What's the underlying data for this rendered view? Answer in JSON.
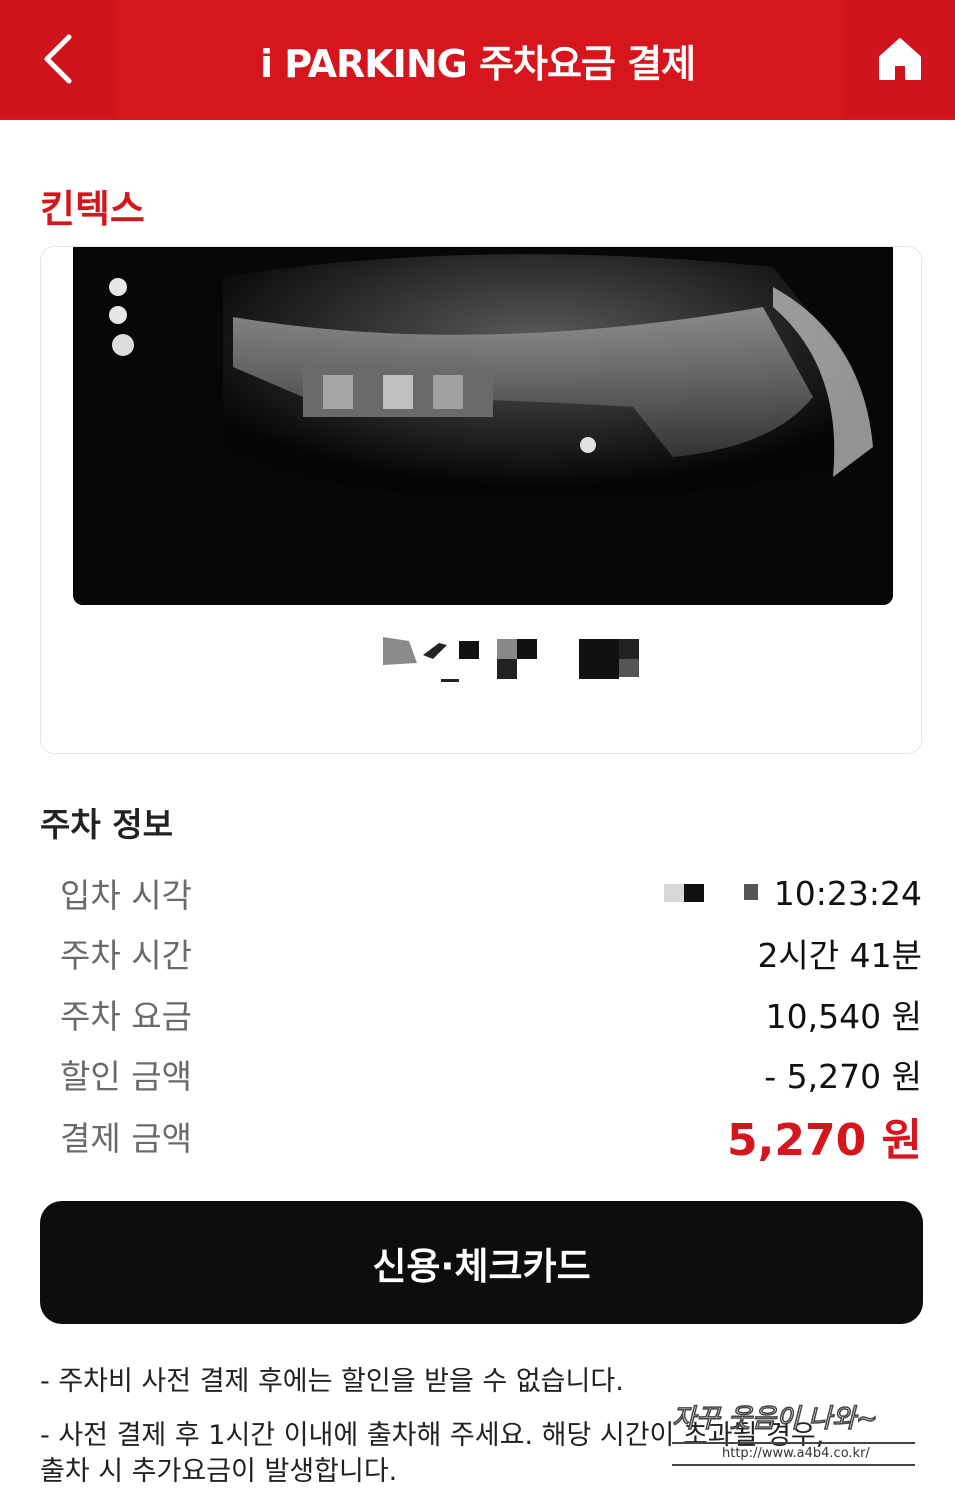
{
  "header": {
    "title": "i PARKING 주차요금 결제",
    "back_icon": "chevron-left-icon",
    "home_icon": "home-icon",
    "bg_color": "#d7151c"
  },
  "parking_lot": {
    "name": "킨텍스"
  },
  "car": {
    "photo": "blurred-front-of-car-photo",
    "plate_number": "[blurred]"
  },
  "parking_info": {
    "section_title": "주차 정보",
    "rows": [
      {
        "label": "입차 시각",
        "value": "10:23:24"
      },
      {
        "label": "주차 시간",
        "value": "2시간 41분"
      },
      {
        "label": "주차 요금",
        "value": "10,540 원"
      },
      {
        "label": "할인 금액",
        "value": "- 5,270 원"
      },
      {
        "label": "결제 금액",
        "value": "5,270 원"
      }
    ]
  },
  "payment": {
    "button_label": "신용·체크카드"
  },
  "notices": [
    "- 주차비 사전 결제 후에는 할인을 받을 수 없습니다.",
    "- 사전 결제 후 1시간 이내에 출차해 주세요. 해당 시간이 초과될 경우,",
    "출차 시 추가요금이 발생합니다."
  ],
  "watermark": {
    "text": "자꾸 웃음이 나와~",
    "url": "http://www.a4b4.co.kr/"
  },
  "colors": {
    "accent": "#d7151c",
    "button": "#0d0d0d"
  }
}
